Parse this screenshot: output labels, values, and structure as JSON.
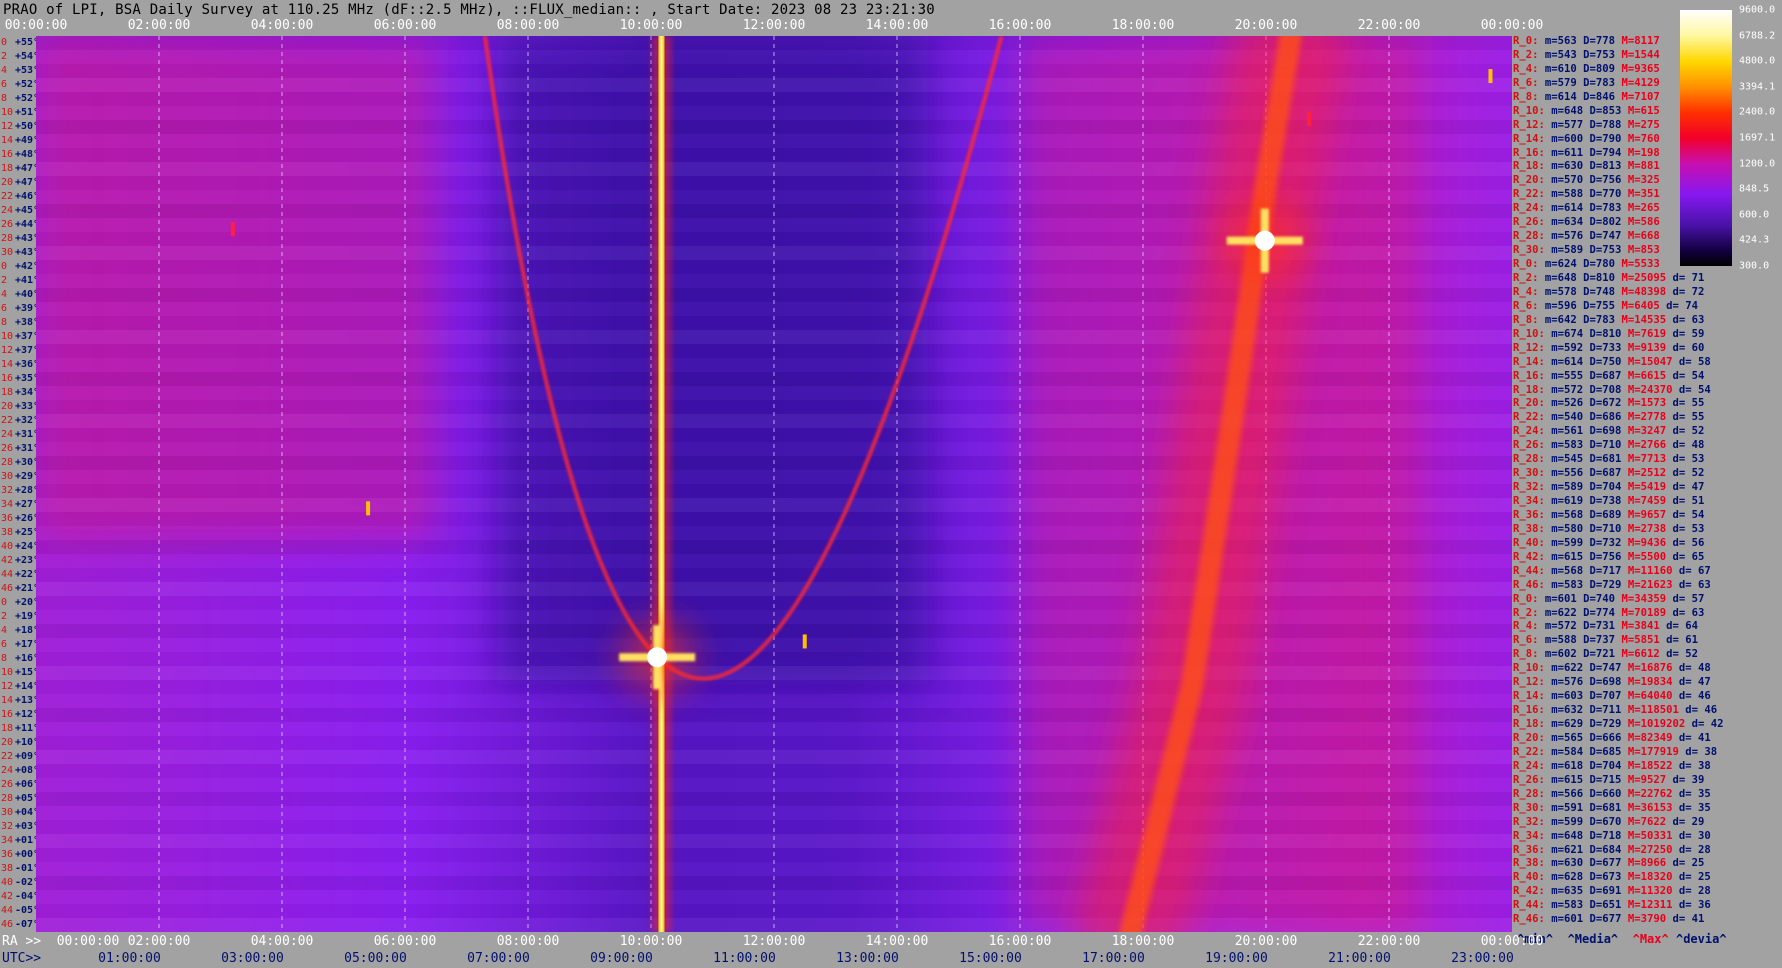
{
  "header": {
    "title": "PRAO of LPI, BSA Daily Survey at 110.25 MHz (dF::2.5 MHz), ::FLUX_median:: , Start Date: 2023 08 23 23:21:30"
  },
  "chart_data": {
    "type": "heatmap",
    "title": "PRAO of LPI, BSA Daily Survey at 110.25 MHz (dF::2.5 MHz), ::FLUX_median:: , Start Date: 2023 08 23 23:21:30",
    "x_axis_top": {
      "ticks": [
        "00:00:00",
        "02:00:00",
        "04:00:00",
        "06:00:00",
        "08:00:00",
        "10:00:00",
        "12:00:00",
        "14:00:00",
        "16:00:00",
        "18:00:00",
        "20:00:00",
        "22:00:00",
        "00:00:00"
      ],
      "positions_hours": [
        0,
        2,
        4,
        6,
        8,
        10,
        12,
        14,
        16,
        18,
        20,
        22,
        24
      ]
    },
    "x_axis_bottom_ra": {
      "label": "RA >>",
      "ticks": [
        "00:00:00",
        "02:00:00",
        "04:00:00",
        "06:00:00",
        "08:00:00",
        "10:00:00",
        "12:00:00",
        "14:00:00",
        "16:00:00",
        "18:00:00",
        "20:00:00",
        "22:00:00",
        "00:00:00"
      ],
      "positions_hours": [
        0,
        2,
        4,
        6,
        8,
        10,
        12,
        14,
        16,
        18,
        20,
        22,
        24
      ]
    },
    "x_axis_bottom_utc": {
      "label": "UTC>>",
      "ticks": [
        "01:00:00",
        "03:00:00",
        "05:00:00",
        "07:00:00",
        "09:00:00",
        "11:00:00",
        "13:00:00",
        "15:00:00",
        "17:00:00",
        "19:00:00",
        "21:00:00",
        "23:00:00"
      ],
      "positions_hours": [
        1.52,
        3.52,
        5.52,
        7.52,
        9.52,
        11.52,
        13.52,
        15.52,
        17.52,
        19.52,
        21.52,
        23.52
      ]
    },
    "y_axis": {
      "rows": [
        {
          "i": "0",
          "dec": "+55°17'"
        },
        {
          "i": "2",
          "dec": "+54°29'"
        },
        {
          "i": "4",
          "dec": "+53°40'"
        },
        {
          "i": "6",
          "dec": "+52°52'"
        },
        {
          "i": "8",
          "dec": "+52°03'"
        },
        {
          "i": "10",
          "dec": "+51°15'"
        },
        {
          "i": "12",
          "dec": "+50°26'"
        },
        {
          "i": "14",
          "dec": "+49°38'"
        },
        {
          "i": "16",
          "dec": "+48°46'"
        },
        {
          "i": "18",
          "dec": "+47°58'"
        },
        {
          "i": "20",
          "dec": "+47°09'"
        },
        {
          "i": "22",
          "dec": "+46°20'"
        },
        {
          "i": "24",
          "dec": "+45°31'"
        },
        {
          "i": "26",
          "dec": "+44°41'"
        },
        {
          "i": "28",
          "dec": "+43°52'"
        },
        {
          "i": "30",
          "dec": "+43°03'"
        },
        {
          "i": "0",
          "dec": "+42°08'"
        },
        {
          "i": "2",
          "dec": "+41°19'"
        },
        {
          "i": "4",
          "dec": "+40°28'"
        },
        {
          "i": "6",
          "dec": "+39°38'"
        },
        {
          "i": "8",
          "dec": "+38°47'"
        },
        {
          "i": "10",
          "dec": "+37°57'"
        },
        {
          "i": "12",
          "dec": "+37°07'"
        },
        {
          "i": "14",
          "dec": "+36°16'"
        },
        {
          "i": "16",
          "dec": "+35°24'"
        },
        {
          "i": "18",
          "dec": "+34°32'"
        },
        {
          "i": "20",
          "dec": "+33°41'"
        },
        {
          "i": "22",
          "dec": "+32°49'"
        },
        {
          "i": "24",
          "dec": "+31°56'"
        },
        {
          "i": "26",
          "dec": "+31°04'"
        },
        {
          "i": "28",
          "dec": "+30°10'"
        },
        {
          "i": "30",
          "dec": "+29°17'"
        },
        {
          "i": "32",
          "dec": "+28°22'"
        },
        {
          "i": "34",
          "dec": "+27°28'"
        },
        {
          "i": "36",
          "dec": "+26°34'"
        },
        {
          "i": "38",
          "dec": "+25°38'"
        },
        {
          "i": "40",
          "dec": "+24°42'"
        },
        {
          "i": "42",
          "dec": "+23°46'"
        },
        {
          "i": "44",
          "dec": "+22°49'"
        },
        {
          "i": "46",
          "dec": "+21°52'"
        },
        {
          "i": "0",
          "dec": "+20°50'"
        },
        {
          "i": "2",
          "dec": "+19°53'"
        },
        {
          "i": "4",
          "dec": "+18°55'"
        },
        {
          "i": "6",
          "dec": "+17°55'"
        },
        {
          "i": "8",
          "dec": "+16°52'"
        },
        {
          "i": "10",
          "dec": "+15°50'"
        },
        {
          "i": "12",
          "dec": "+14°48'"
        },
        {
          "i": "14",
          "dec": "+13°44'"
        },
        {
          "i": "16",
          "dec": "+12°38'"
        },
        {
          "i": "18",
          "dec": "+11°32'"
        },
        {
          "i": "20",
          "dec": "+10°25'"
        },
        {
          "i": "22",
          "dec": "+09°17'"
        },
        {
          "i": "24",
          "dec": "+08°05'"
        },
        {
          "i": "26",
          "dec": "+06°54'"
        },
        {
          "i": "28",
          "dec": "+05°41'"
        },
        {
          "i": "30",
          "dec": "+04°25'"
        },
        {
          "i": "32",
          "dec": "+03°07'"
        },
        {
          "i": "34",
          "dec": "+01°47'"
        },
        {
          "i": "36",
          "dec": "+00°25'"
        },
        {
          "i": "38",
          "dec": "-01°00'"
        },
        {
          "i": "40",
          "dec": "-02°30'"
        },
        {
          "i": "42",
          "dec": "-04°01'"
        },
        {
          "i": "44",
          "dec": "-05°37'"
        },
        {
          "i": "46",
          "dec": "-07°19'"
        }
      ]
    },
    "colorbar": {
      "labels": [
        "9600.0",
        "6788.2",
        "4800.0",
        "3394.1",
        "2400.0",
        "1697.1",
        "1200.0",
        "848.5",
        "600.0",
        "424.3",
        "300.0"
      ],
      "vmin": 300.0,
      "vmax": 9600.0,
      "scale": "log"
    },
    "features": [
      {
        "kind": "vertical_band",
        "ra_hours": 10.17,
        "dec_from": 55.3,
        "dec_to": -7.3,
        "intensity": "max"
      },
      {
        "kind": "bright_source",
        "ra_hours": 10.1,
        "dec": 11.9,
        "intensity": "max"
      },
      {
        "kind": "bright_source",
        "ra_hours": 19.98,
        "dec": 41.0,
        "intensity": "max"
      },
      {
        "kind": "parabola",
        "vertex_ra_hours": 10.2,
        "vertex_dec": 11.5,
        "top_left_ra_hours": 7.3,
        "top_right_ra_hours": 15.7,
        "top_dec": 55.3,
        "intensity": "high"
      },
      {
        "kind": "galactic_plane",
        "ra_hours": [
          17.8,
          18.8,
          19.5,
          20.0,
          20.4
        ],
        "dec": [
          -7.3,
          10.0,
          30.0,
          45.0,
          55.3
        ],
        "intensity": "high"
      },
      {
        "kind": "diffuse_region",
        "ra_from": 0.0,
        "ra_to": 6.5,
        "dec_from": 55.3,
        "dec_to": 20.0,
        "intensity": "medium"
      },
      {
        "kind": "diffuse_region",
        "ra_from": 16.0,
        "ra_to": 22.5,
        "dec_from": 55.3,
        "dec_to": -7.3,
        "intensity": "medium"
      },
      {
        "kind": "dark_region",
        "ra_from": 7.5,
        "ra_to": 14.5,
        "dec_from": 55.3,
        "dec_to": 10.0,
        "intensity": "low"
      },
      {
        "kind": "point_source",
        "ra_hours": 5.4,
        "dec": 22.3,
        "intensity": "high"
      },
      {
        "kind": "point_source",
        "ra_hours": 12.5,
        "dec": 13.0,
        "intensity": "high"
      },
      {
        "kind": "point_source",
        "ra_hours": 23.65,
        "dec": 52.5,
        "intensity": "high"
      },
      {
        "kind": "point_source",
        "ra_hours": 20.7,
        "dec": 49.5,
        "intensity": "medium"
      },
      {
        "kind": "point_source",
        "ra_hours": 3.2,
        "dec": 41.8,
        "intensity": "medium"
      }
    ]
  },
  "stats": {
    "rows": [
      {
        "r": "R_0:",
        "m": "m=563 D=778",
        "x": "M=8117",
        "d": ""
      },
      {
        "r": "R_2:",
        "m": "m=543 D=753",
        "x": "M=1544",
        "d": ""
      },
      {
        "r": "R_4:",
        "m": "m=610 D=809",
        "x": "M=9365",
        "d": ""
      },
      {
        "r": "R_6:",
        "m": "m=579 D=783",
        "x": "M=4129",
        "d": ""
      },
      {
        "r": "R_8:",
        "m": "m=614 D=846",
        "x": "M=7107",
        "d": ""
      },
      {
        "r": "R_10:",
        "m": "m=648 D=853",
        "x": "M=615",
        "d": ""
      },
      {
        "r": "R_12:",
        "m": "m=577 D=788",
        "x": "M=275",
        "d": ""
      },
      {
        "r": "R_14:",
        "m": "m=600 D=790",
        "x": "M=760",
        "d": ""
      },
      {
        "r": "R_16:",
        "m": "m=611 D=794",
        "x": "M=198",
        "d": ""
      },
      {
        "r": "R_18:",
        "m": "m=630 D=813",
        "x": "M=881",
        "d": ""
      },
      {
        "r": "R_20:",
        "m": "m=570 D=756",
        "x": "M=325",
        "d": ""
      },
      {
        "r": "R_22:",
        "m": "m=588 D=770",
        "x": "M=351",
        "d": ""
      },
      {
        "r": "R_24:",
        "m": "m=614 D=783",
        "x": "M=265",
        "d": ""
      },
      {
        "r": "R_26:",
        "m": "m=634 D=802",
        "x": "M=586",
        "d": ""
      },
      {
        "r": "R_28:",
        "m": "m=576 D=747",
        "x": "M=668",
        "d": ""
      },
      {
        "r": "R_30:",
        "m": "m=589 D=753",
        "x": "M=853",
        "d": ""
      },
      {
        "r": "R_0:",
        "m": "m=624 D=780",
        "x": "M=5533",
        "d": ""
      },
      {
        "r": "R_2:",
        "m": "m=648 D=810",
        "x": "M=25095",
        "d": "d= 71"
      },
      {
        "r": "R_4:",
        "m": "m=578 D=748",
        "x": "M=48398",
        "d": "d= 72"
      },
      {
        "r": "R_6:",
        "m": "m=596 D=755",
        "x": "M=6405",
        "d": "d= 74"
      },
      {
        "r": "R_8:",
        "m": "m=642 D=783",
        "x": "M=14535",
        "d": "d= 63"
      },
      {
        "r": "R_10:",
        "m": "m=674 D=810",
        "x": "M=7619",
        "d": "d= 59"
      },
      {
        "r": "R_12:",
        "m": "m=592 D=733",
        "x": "M=9139",
        "d": "d= 60"
      },
      {
        "r": "R_14:",
        "m": "m=614 D=750",
        "x": "M=15047",
        "d": "d= 58"
      },
      {
        "r": "R_16:",
        "m": "m=555 D=687",
        "x": "M=6615",
        "d": "d= 54"
      },
      {
        "r": "R_18:",
        "m": "m=572 D=708",
        "x": "M=24370",
        "d": "d= 54"
      },
      {
        "r": "R_20:",
        "m": "m=526 D=672",
        "x": "M=1573",
        "d": "d= 55"
      },
      {
        "r": "R_22:",
        "m": "m=540 D=686",
        "x": "M=2778",
        "d": "d= 55"
      },
      {
        "r": "R_24:",
        "m": "m=561 D=698",
        "x": "M=3247",
        "d": "d= 52"
      },
      {
        "r": "R_26:",
        "m": "m=583 D=710",
        "x": "M=2766",
        "d": "d= 48"
      },
      {
        "r": "R_28:",
        "m": "m=545 D=681",
        "x": "M=7713",
        "d": "d= 53"
      },
      {
        "r": "R_30:",
        "m": "m=556 D=687",
        "x": "M=2512",
        "d": "d= 52"
      },
      {
        "r": "R_32:",
        "m": "m=589 D=704",
        "x": "M=5419",
        "d": "d= 47"
      },
      {
        "r": "R_34:",
        "m": "m=619 D=738",
        "x": "M=7459",
        "d": "d= 51"
      },
      {
        "r": "R_36:",
        "m": "m=568 D=689",
        "x": "M=9657",
        "d": "d= 54"
      },
      {
        "r": "R_38:",
        "m": "m=580 D=710",
        "x": "M=2738",
        "d": "d= 53"
      },
      {
        "r": "R_40:",
        "m": "m=599 D=732",
        "x": "M=9436",
        "d": "d= 56"
      },
      {
        "r": "R_42:",
        "m": "m=615 D=756",
        "x": "M=5500",
        "d": "d= 65"
      },
      {
        "r": "R_44:",
        "m": "m=568 D=717",
        "x": "M=11160",
        "d": "d= 67"
      },
      {
        "r": "R_46:",
        "m": "m=583 D=729",
        "x": "M=21623",
        "d": "d= 63"
      },
      {
        "r": "R_0:",
        "m": "m=601 D=740",
        "x": "M=34359",
        "d": "d= 57"
      },
      {
        "r": "R_2:",
        "m": "m=622 D=774",
        "x": "M=70189",
        "d": "d= 63"
      },
      {
        "r": "R_4:",
        "m": "m=572 D=731",
        "x": "M=3841",
        "d": "d= 64"
      },
      {
        "r": "R_6:",
        "m": "m=588 D=737",
        "x": "M=5851",
        "d": "d= 61"
      },
      {
        "r": "R_8:",
        "m": "m=602 D=721",
        "x": "M=6612",
        "d": "d= 52"
      },
      {
        "r": "R_10:",
        "m": "m=622 D=747",
        "x": "M=16876",
        "d": "d= 48"
      },
      {
        "r": "R_12:",
        "m": "m=576 D=698",
        "x": "M=19834",
        "d": "d= 47"
      },
      {
        "r": "R_14:",
        "m": "m=603 D=707",
        "x": "M=64040",
        "d": "d= 46"
      },
      {
        "r": "R_16:",
        "m": "m=632 D=711",
        "x": "M=118501",
        "d": "d= 46"
      },
      {
        "r": "R_18:",
        "m": "m=629 D=729",
        "x": "M=1019202",
        "d": "d= 42"
      },
      {
        "r": "R_20:",
        "m": "m=565 D=666",
        "x": "M=82349",
        "d": "d= 41"
      },
      {
        "r": "R_22:",
        "m": "m=584 D=685",
        "x": "M=177919",
        "d": "d= 38"
      },
      {
        "r": "R_24:",
        "m": "m=618 D=704",
        "x": "M=18522",
        "d": "d= 38"
      },
      {
        "r": "R_26:",
        "m": "m=615 D=715",
        "x": "M=9527",
        "d": "d= 39"
      },
      {
        "r": "R_28:",
        "m": "m=566 D=660",
        "x": "M=22762",
        "d": "d= 35"
      },
      {
        "r": "R_30:",
        "m": "m=591 D=681",
        "x": "M=36153",
        "d": "d= 35"
      },
      {
        "r": "R_32:",
        "m": "m=599 D=670",
        "x": "M=7622",
        "d": "d= 29"
      },
      {
        "r": "R_34:",
        "m": "m=648 D=718",
        "x": "M=50331",
        "d": "d= 30"
      },
      {
        "r": "R_36:",
        "m": "m=621 D=684",
        "x": "M=27250",
        "d": "d= 28"
      },
      {
        "r": "R_38:",
        "m": "m=630 D=677",
        "x": "M=8966",
        "d": "d= 25"
      },
      {
        "r": "R_40:",
        "m": "m=628 D=673",
        "x": "M=18320",
        "d": "d= 25"
      },
      {
        "r": "R_42:",
        "m": "m=635 D=691",
        "x": "M=11320",
        "d": "d= 28"
      },
      {
        "r": "R_44:",
        "m": "m=583 D=651",
        "x": "M=12311",
        "d": "d= 36"
      },
      {
        "r": "R_46:",
        "m": "m=601 D=677",
        "x": "M=3790",
        "d": "d= 41"
      }
    ],
    "footer": {
      "min": "^min^",
      "median": "^Media^",
      "max": "^Max^",
      "devia": "^devia^"
    }
  },
  "bottom": {
    "ra_label": "RA >>",
    "utc_label": "UTC>>"
  }
}
